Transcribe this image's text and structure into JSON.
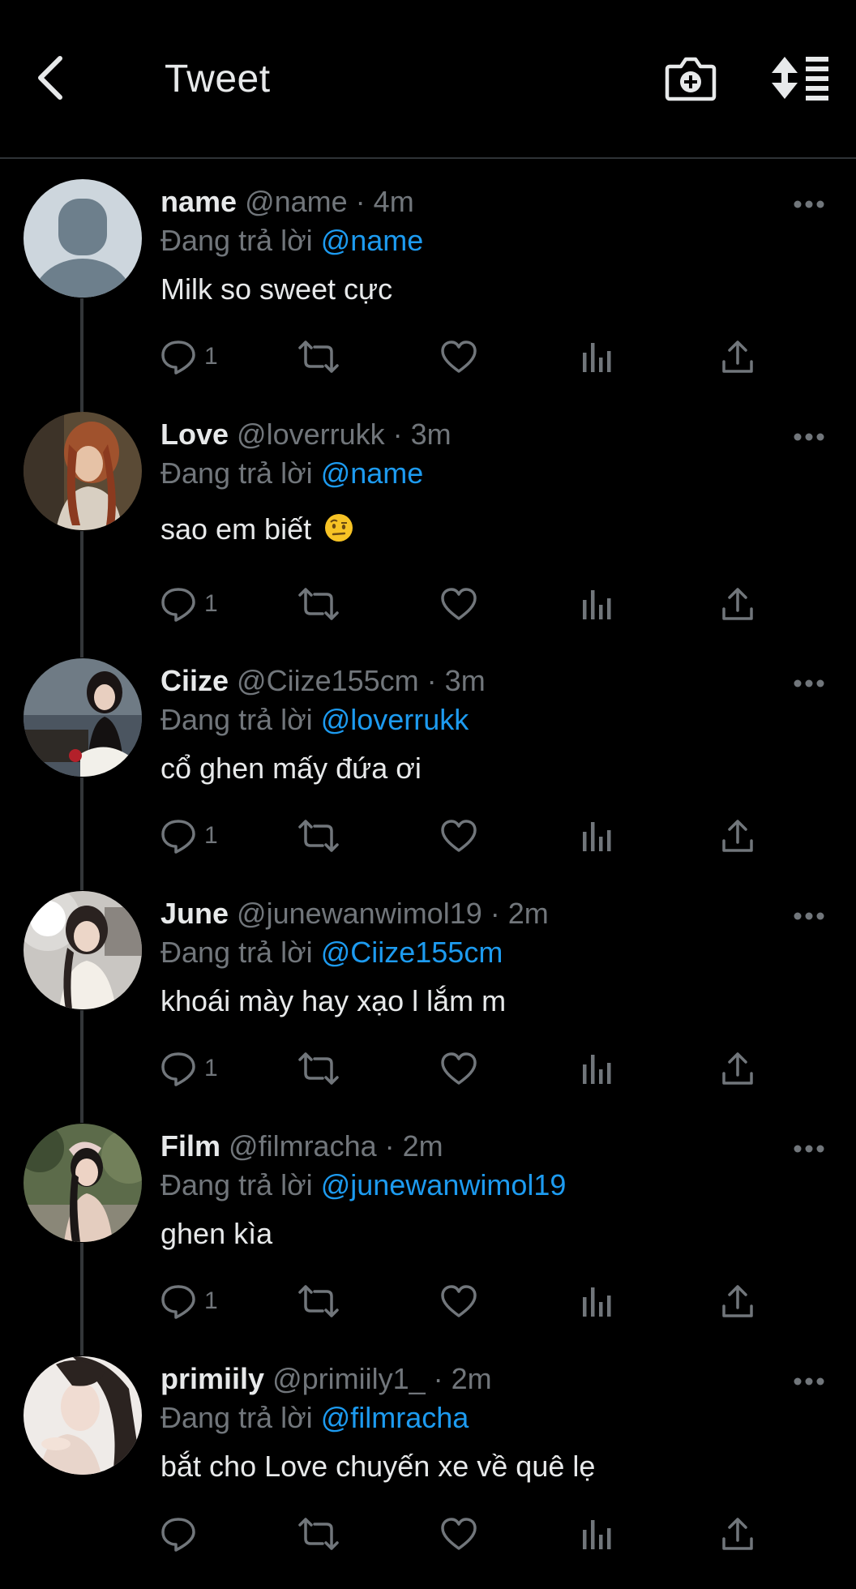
{
  "header": {
    "title": "Tweet"
  },
  "tweets": [
    {
      "name": "name",
      "handle": "@name",
      "time": "4m",
      "replying_prefix": "Đang trả lời ",
      "replying_to": "@name",
      "text": "Milk so sweet cực",
      "reply_count": "1",
      "avatar": "default-avatar"
    },
    {
      "name": "Love",
      "handle": "@loverrukk",
      "time": "3m",
      "replying_prefix": "Đang trả lời ",
      "replying_to": "@name",
      "text": "sao em biết",
      "emoji": "face-with-raised-eyebrow",
      "reply_count": "1",
      "avatar": "photo-redhair"
    },
    {
      "name": "Ciize",
      "handle": "@Ciize155cm",
      "time": "3m",
      "replying_prefix": "Đang trả lời ",
      "replying_to": "@loverrukk",
      "text": "cổ ghen mấy đứa ơi",
      "reply_count": "1",
      "avatar": "photo-lake"
    },
    {
      "name": "June",
      "handle": "@junewanwimol19",
      "time": "2m",
      "replying_prefix": "Đang trả lời ",
      "replying_to": "@Ciize155cm",
      "text": "khoái mày hay xạo l lắm m",
      "reply_count": "1",
      "avatar": "photo-light"
    },
    {
      "name": "Film",
      "handle": "@filmracha",
      "time": "2m",
      "replying_prefix": "Đang trả lời ",
      "replying_to": "@junewanwimol19",
      "text": "ghen kìa",
      "reply_count": "1",
      "avatar": "photo-trees"
    },
    {
      "name": "primiily",
      "handle": "@primiily1_",
      "time": "2m",
      "replying_prefix": "Đang trả lời ",
      "replying_to": "@filmracha",
      "text": "bắt cho Love chuyến xe về quê lẹ",
      "reply_count": "",
      "avatar": "photo-portrait"
    }
  ],
  "colors": {
    "background": "#000000",
    "text": "#e7e9ea",
    "secondary": "#71767b",
    "accent": "#1d9bf0",
    "divider": "#2f3336"
  }
}
